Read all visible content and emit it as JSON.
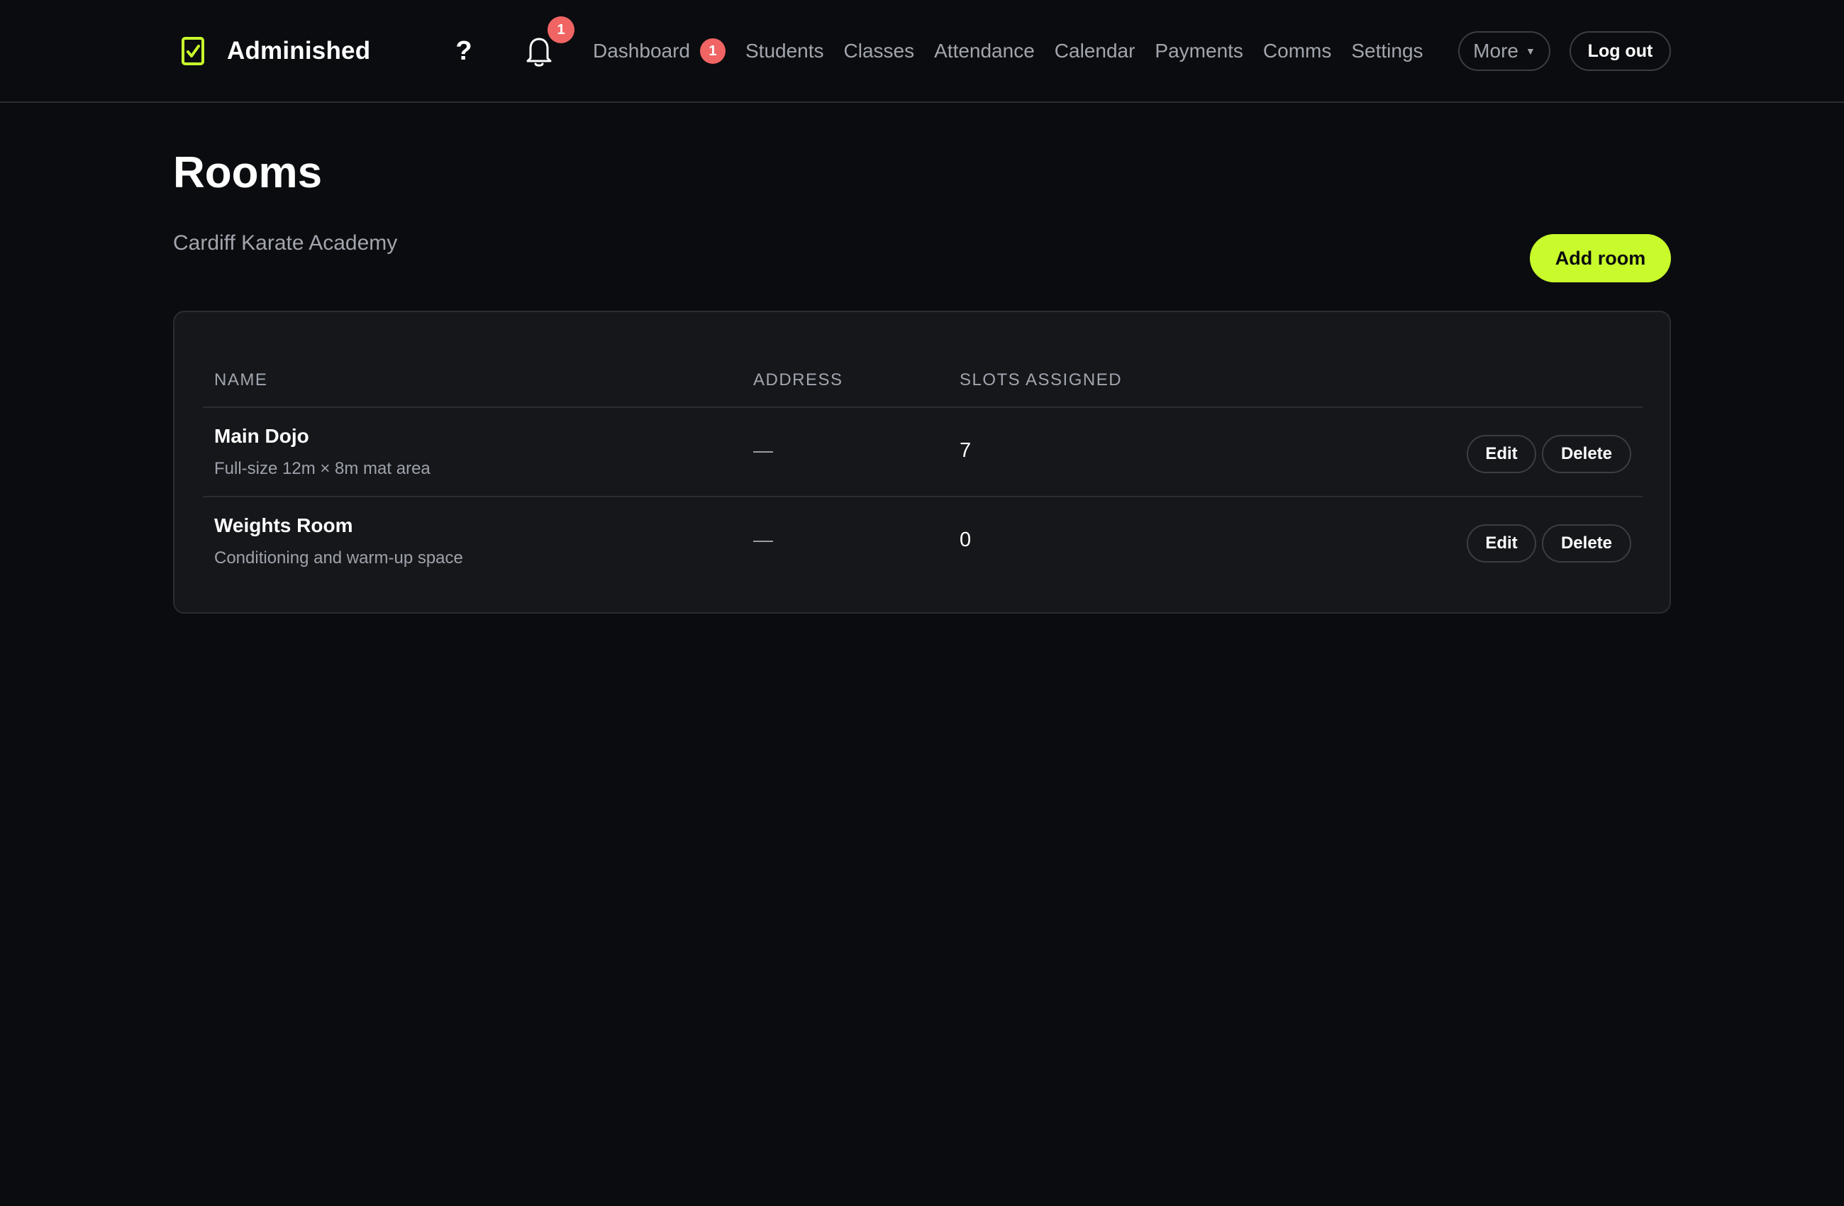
{
  "app": {
    "name": "Adminished",
    "logo_icon": "checkbox-clipboard-icon",
    "accent_color": "#c8fa2c",
    "badge_color": "#f06464"
  },
  "header": {
    "help_label": "?",
    "notifications": {
      "icon": "bell-icon",
      "count": "1"
    },
    "nav": [
      {
        "label": "Dashboard",
        "badge": "1"
      },
      {
        "label": "Students"
      },
      {
        "label": "Classes"
      },
      {
        "label": "Attendance"
      },
      {
        "label": "Calendar"
      },
      {
        "label": "Payments"
      },
      {
        "label": "Comms"
      },
      {
        "label": "Settings"
      }
    ],
    "more_label": "More",
    "logout_label": "Log out"
  },
  "page": {
    "title": "Rooms",
    "subtitle": "Cardiff Karate Academy",
    "add_button_label": "Add room"
  },
  "table": {
    "columns": [
      "NAME",
      "ADDRESS",
      "SLOTS ASSIGNED"
    ],
    "rows": [
      {
        "name": "Main Dojo",
        "description": "Full-size 12m × 8m mat area",
        "address": "—",
        "slots": "7",
        "edit_label": "Edit",
        "delete_label": "Delete"
      },
      {
        "name": "Weights Room",
        "description": "Conditioning and warm-up space",
        "address": "—",
        "slots": "0",
        "edit_label": "Edit",
        "delete_label": "Delete"
      }
    ]
  }
}
